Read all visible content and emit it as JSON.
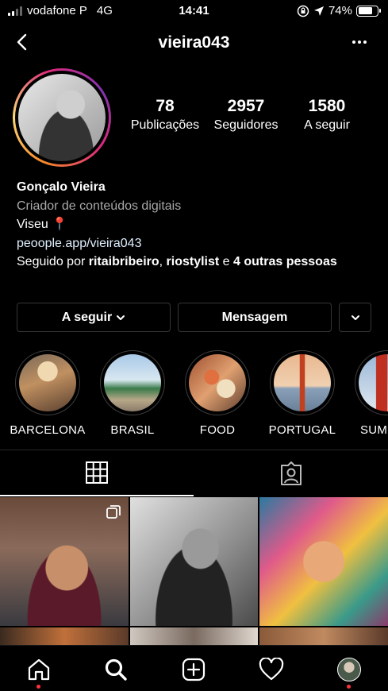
{
  "status_bar": {
    "carrier": "vodafone P",
    "network": "4G",
    "time": "14:41",
    "battery": "74%",
    "battery_level": 0.74
  },
  "header": {
    "username": "vieira043",
    "back_icon": "chevron-left-icon",
    "more_icon": "more-horizontal-icon"
  },
  "stats": {
    "posts": {
      "value": "78",
      "label": "Publicações"
    },
    "followers": {
      "value": "2957",
      "label": "Seguidores"
    },
    "following": {
      "value": "1580",
      "label": "A seguir"
    }
  },
  "bio": {
    "name": "Gonçalo Vieira",
    "category": "Criador de conteúdos digitais",
    "location": "Viseu",
    "location_emoji": "📍",
    "link": "peoople.app/vieira043",
    "followed_by_prefix": "Seguido por ",
    "followed_by_user1": "ritaibribeiro",
    "followed_by_sep": ", ",
    "followed_by_user2": "riostylist",
    "followed_by_conj": " e ",
    "followed_by_others": "4 outras pessoas"
  },
  "actions": {
    "follow_label": "A seguir",
    "message_label": "Mensagem"
  },
  "highlights": [
    {
      "label": "BARCELONA",
      "color": "#b07a50"
    },
    {
      "label": "BRASIL",
      "color": "#4a8a6a"
    },
    {
      "label": "FOOD",
      "color": "#c86a40"
    },
    {
      "label": "PORTUGAL",
      "color": "#d88a5a"
    },
    {
      "label": "SUM",
      "color": "#c04030"
    }
  ],
  "tabs": {
    "grid_icon": "grid-icon",
    "tagged_icon": "tagged-user-icon"
  },
  "bottom_nav": {
    "home_icon": "home-icon",
    "search_icon": "search-icon",
    "add_icon": "add-post-icon",
    "activity_icon": "heart-icon",
    "profile_icon": "profile-avatar"
  }
}
